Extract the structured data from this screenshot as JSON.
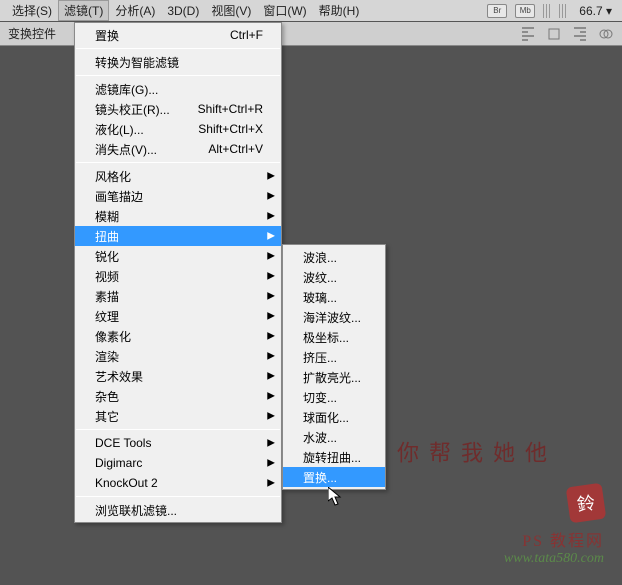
{
  "menubar": {
    "items": [
      {
        "label": "选择(S)"
      },
      {
        "label": "滤镜(T)"
      },
      {
        "label": "分析(A)"
      },
      {
        "label": "3D(D)"
      },
      {
        "label": "视图(V)"
      },
      {
        "label": "窗口(W)"
      },
      {
        "label": "帮助(H)"
      }
    ],
    "badges": {
      "br": "Br",
      "mb": "Mb"
    },
    "zoom": "66.7"
  },
  "optbar": {
    "label": "变换控件"
  },
  "filter_menu": {
    "last": {
      "label": "置换",
      "shortcut": "Ctrl+F"
    },
    "smart": "转换为智能滤镜",
    "group1": [
      {
        "label": "滤镜库(G)...",
        "shortcut": ""
      },
      {
        "label": "镜头校正(R)...",
        "shortcut": "Shift+Ctrl+R"
      },
      {
        "label": "液化(L)...",
        "shortcut": "Shift+Ctrl+X"
      },
      {
        "label": "消失点(V)...",
        "shortcut": "Alt+Ctrl+V"
      }
    ],
    "cats": [
      "风格化",
      "画笔描边",
      "模糊",
      "扭曲",
      "锐化",
      "视频",
      "素描",
      "纹理",
      "像素化",
      "渲染",
      "艺术效果",
      "杂色",
      "其它"
    ],
    "plugs": [
      "DCE Tools",
      "Digimarc",
      "KnockOut 2"
    ],
    "browse": "浏览联机滤镜..."
  },
  "distort_submenu": [
    "波浪...",
    "波纹...",
    "玻璃...",
    "海洋波纹...",
    "极坐标...",
    "挤压...",
    "扩散亮光...",
    "切变...",
    "球面化...",
    "水波...",
    "旋转扭曲...",
    "置换..."
  ],
  "watermark": {
    "script": "他她我帮你",
    "line1": "PS 教程网",
    "line2": "www.tata580.com",
    "stamp": "鈴"
  }
}
